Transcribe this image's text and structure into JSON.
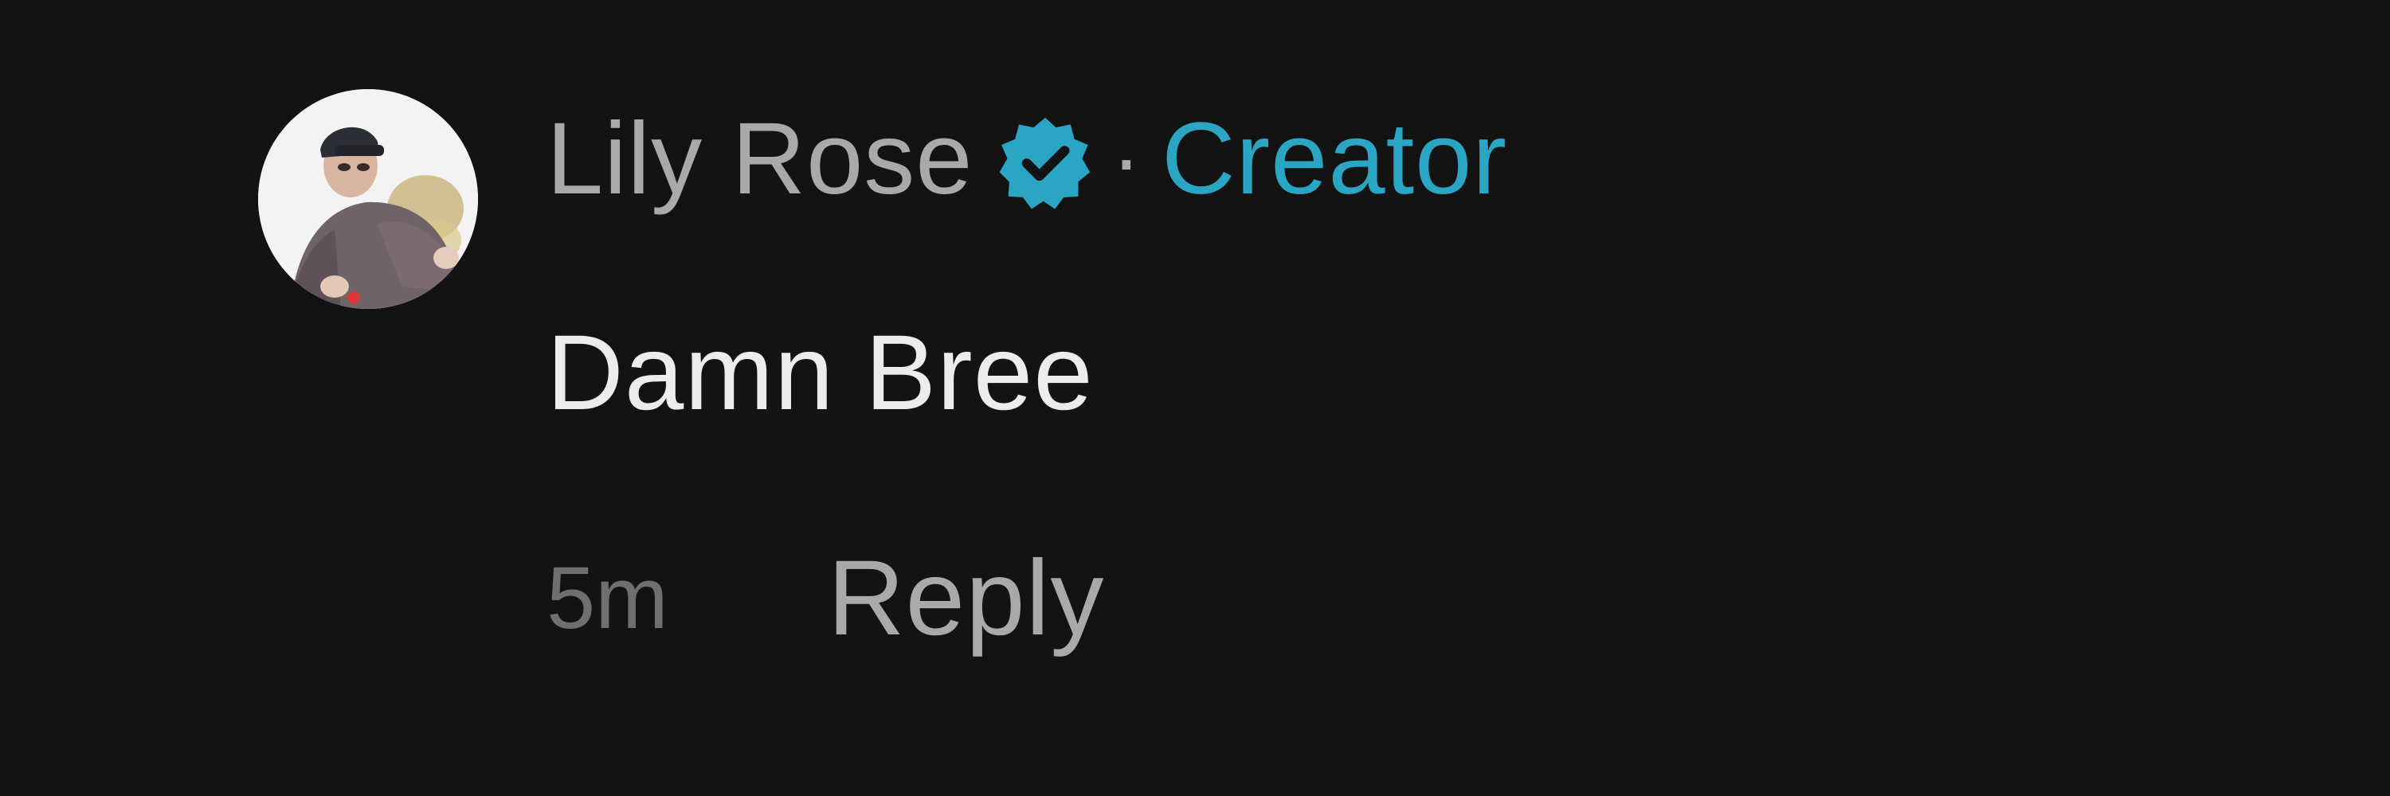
{
  "comment": {
    "author": {
      "name": "Lily Rose",
      "verified": true,
      "role_separator": "·",
      "role_label": "Creator",
      "avatar_icon": "avatar-photo"
    },
    "text": "Damn Bree",
    "timestamp": "5m",
    "reply_label": "Reply"
  },
  "colors": {
    "background": "#131313",
    "author_name": "#a9a9a9",
    "creator_accent": "#2aa6c4",
    "verified_badge": "#2aa6c4",
    "comment_text": "#ececec",
    "timestamp": "#6f6f6f",
    "reply": "#a9a9a9"
  },
  "icons": {
    "verified": "verified-check-badge-icon",
    "avatar": "user-avatar-photo"
  }
}
